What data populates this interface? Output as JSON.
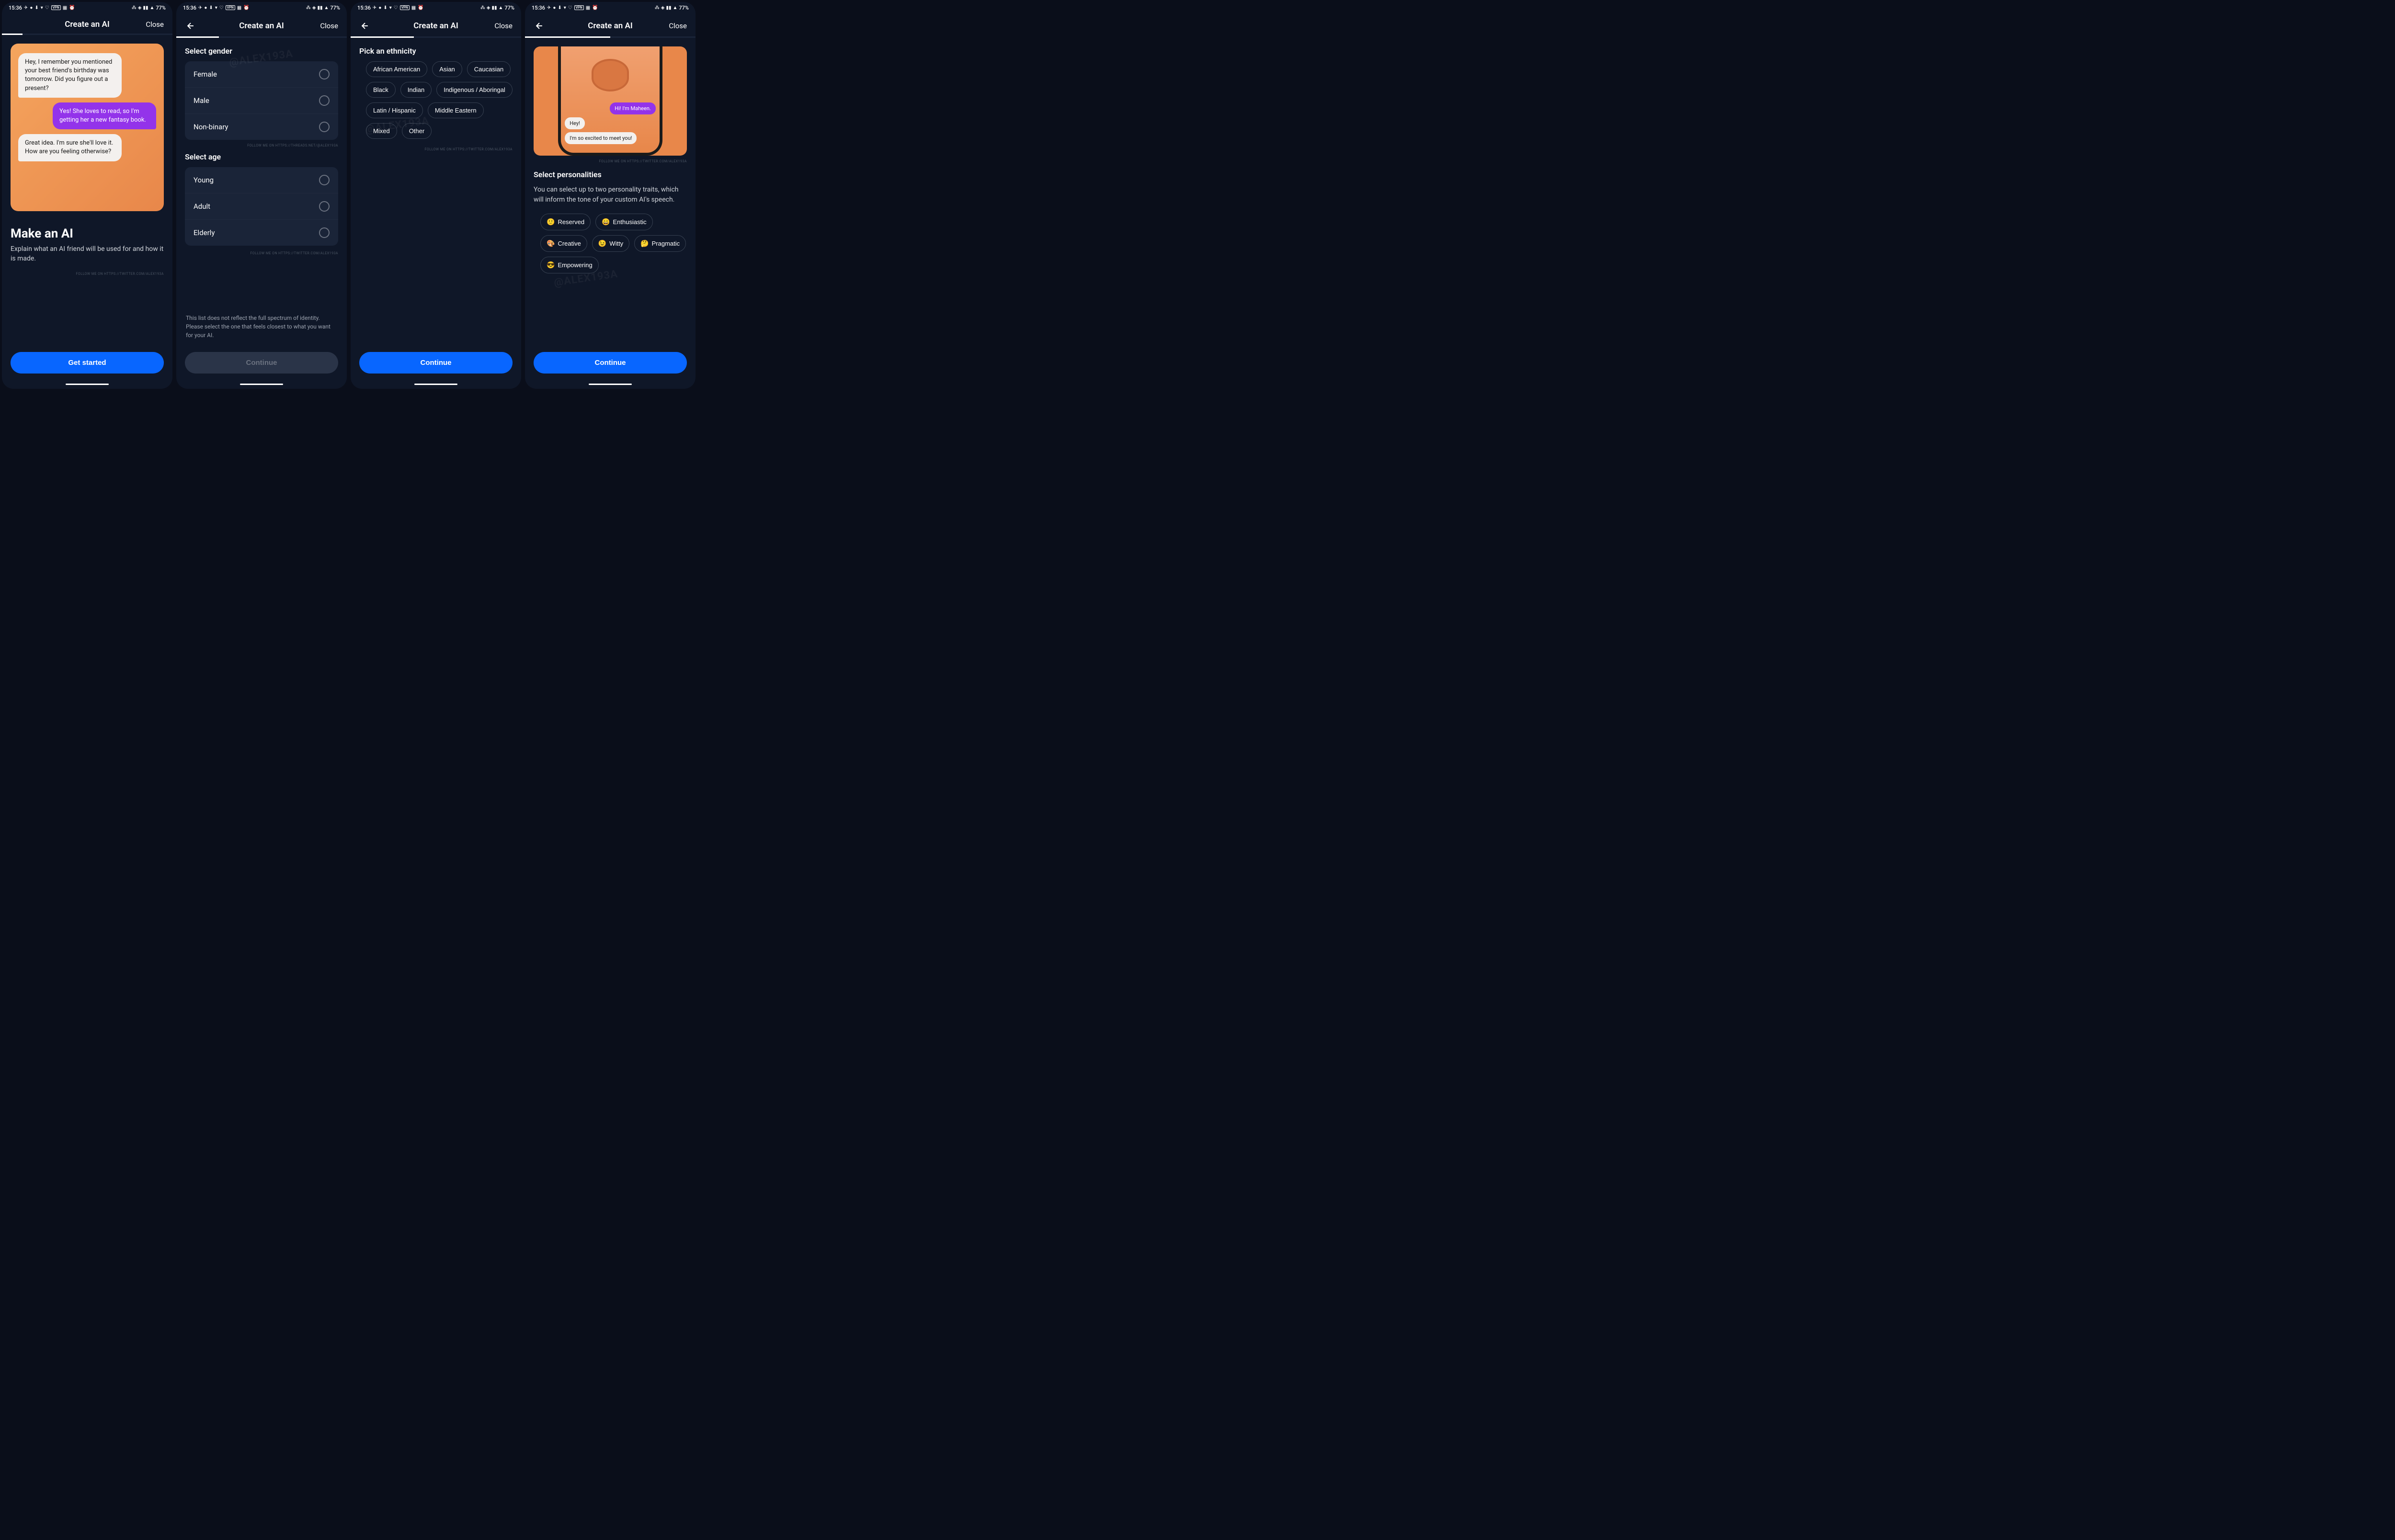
{
  "status": {
    "time": "15:36",
    "battery": "77%",
    "vpn": "VPN"
  },
  "header": {
    "title": "Create an AI",
    "close": "Close"
  },
  "screen1": {
    "bubbles": [
      "Hey, I remember you mentioned your best friend's birthday was tomorrow. Did you figure out a present?",
      "Yes! She loves to read, so I'm getting her a new fantasy book.",
      "Great idea. I'm sure she'll love it. How are you feeling otherwise?"
    ],
    "title": "Make an AI",
    "desc": "Explain what an AI friend will be used for and how it is made.",
    "follow": "FOLLOW ME ON HTTPS://TWITTER.COM/ALEX193A",
    "cta": "Get started"
  },
  "screen2": {
    "gender_title": "Select gender",
    "gender_options": [
      "Female",
      "Male",
      "Non-binary"
    ],
    "age_title": "Select age",
    "age_options": [
      "Young",
      "Adult",
      "Elderly"
    ],
    "follow1": "FOLLOW ME ON HTTPS://THREADS.NET/@ALEX193A",
    "follow2": "FOLLOW ME ON HTTPS://TWITTER.COM/ALEX193A",
    "disclaimer": "This list does not reflect the full spectrum of identity.  Please select the one that feels closest to what you want for your AI.",
    "cta": "Continue"
  },
  "screen3": {
    "title": "Pick an ethnicity",
    "options": [
      "African American",
      "Asian",
      "Caucasian",
      "Black",
      "Indian",
      "Indigenous / Aboringal",
      "Latin / Hispanic",
      "Middle Eastern",
      "Mixed",
      "Other"
    ],
    "follow": "FOLLOW ME ON HTTPS://TWITTER.COM/ALEX193A",
    "cta": "Continue"
  },
  "screen4": {
    "phone_bubbles": [
      "Hi! I'm Maheen.",
      "Hey!",
      "I'm so excited to meet you!"
    ],
    "follow": "FOLLOW ME ON HTTPS://TWITTER.COM/ALEX193A",
    "title": "Select personalities",
    "desc": "You can select up to two personality traits, which will inform the tone of your custom AI's speech.",
    "traits": [
      {
        "emoji": "🙂",
        "label": "Reserved"
      },
      {
        "emoji": "😄",
        "label": "Enthusiastic"
      },
      {
        "emoji": "🎨",
        "label": "Creative"
      },
      {
        "emoji": "😉",
        "label": "Witty"
      },
      {
        "emoji": "🤔",
        "label": "Pragmatic"
      },
      {
        "emoji": "😎",
        "label": "Empowering"
      }
    ],
    "cta": "Continue"
  },
  "watermark": "@ALEX193A"
}
